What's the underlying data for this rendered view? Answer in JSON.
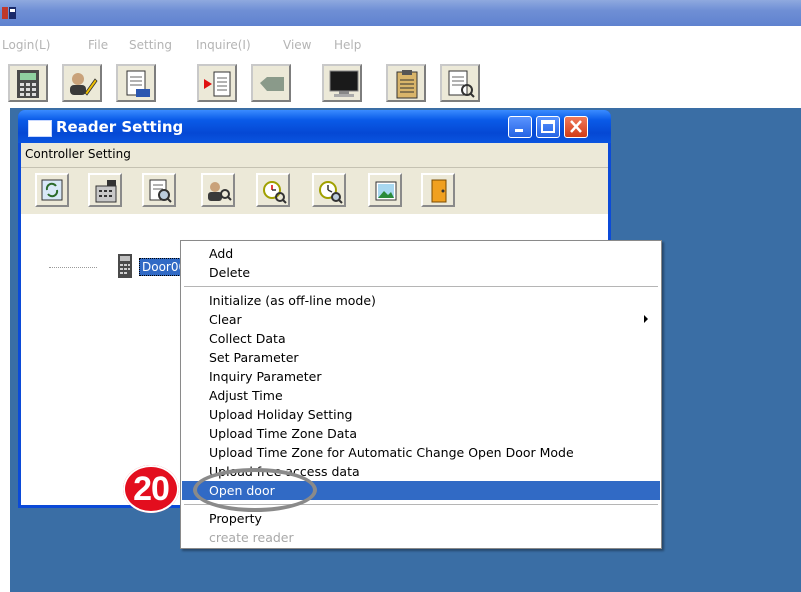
{
  "menubar": {
    "items": [
      "Login(L)",
      "File",
      "Setting",
      "Inquire(I)",
      "View",
      "Help"
    ]
  },
  "toolbar": {
    "buttons": [
      "calculator-icon",
      "user-edit-icon",
      "document-icon",
      "download-icon",
      "disabled-tab-icon",
      "monitor-icon",
      "clipboard-icon",
      "document-search-icon"
    ]
  },
  "reader_window": {
    "title": "Reader Setting",
    "menu_label": "Controller Setting",
    "toolbar_icons": [
      "refresh-icon",
      "controller-icon",
      "search-doc-icon",
      "user-search-icon",
      "alarm-clock-icon",
      "clock-search-icon",
      "picture-icon",
      "door-icon"
    ]
  },
  "tree": {
    "node_label": "Door001"
  },
  "context_menu": {
    "items": [
      {
        "label": "Add"
      },
      {
        "label": "Delete"
      },
      {
        "label": "Initialize (as off-line mode)"
      },
      {
        "label": "Clear",
        "submenu": true
      },
      {
        "label": "Collect Data"
      },
      {
        "label": "Set Parameter"
      },
      {
        "label": "Inquiry Parameter"
      },
      {
        "label": "Adjust Time"
      },
      {
        "label": "Upload Holiday Setting"
      },
      {
        "label": "Upload Time Zone Data"
      },
      {
        "label": "Upload Time Zone for  Automatic Change Open Door Mode"
      },
      {
        "label": "Upload free access data"
      },
      {
        "label": "Open door",
        "highlighted": true
      },
      {
        "label": "Property"
      },
      {
        "label": "create reader",
        "disabled": true
      }
    ]
  },
  "annotation": {
    "step_number": "20"
  },
  "colors": {
    "titlebar_blue": "#0548d4",
    "desktop_blue": "#3a6ea5",
    "highlight": "#316ac5",
    "badge_red": "#e30e1e"
  }
}
